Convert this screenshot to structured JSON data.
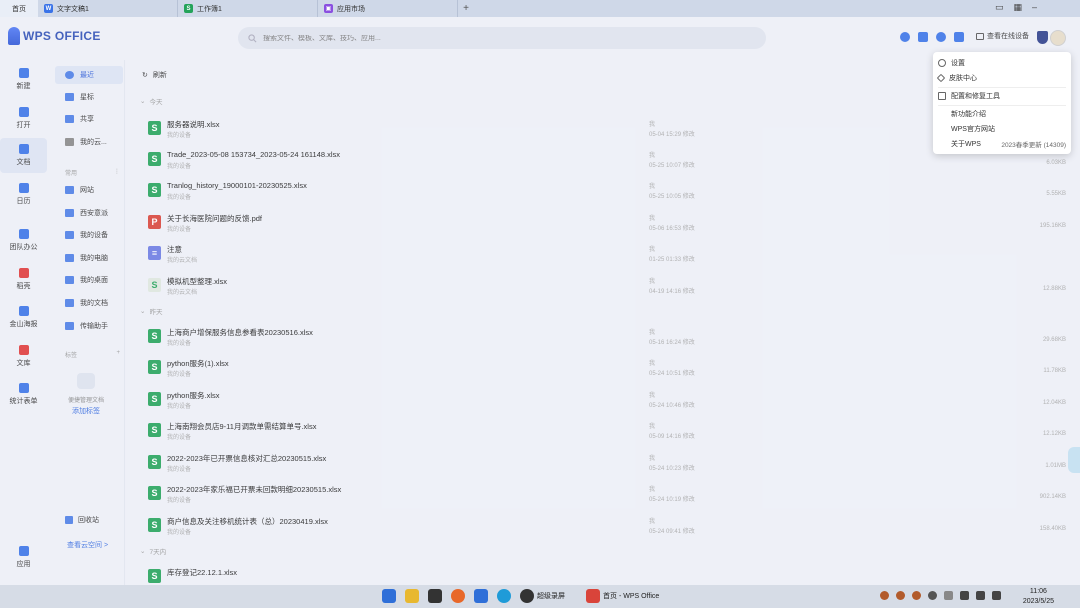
{
  "tabs": [
    {
      "label": "首页",
      "icon": "home-tab",
      "color": "#ffffff"
    },
    {
      "label": "文字文稿1",
      "icon": "writer-doc-icon",
      "color": "#3a73e8",
      "glyph": "W"
    },
    {
      "label": "工作簿1",
      "icon": "spreadsheet-icon",
      "color": "#24a35a",
      "glyph": "S"
    },
    {
      "label": "应用市场",
      "icon": "app-market-icon",
      "color": "#8a4fe0",
      "glyph": "▣"
    }
  ],
  "app": {
    "logo_text": "WPS OFFICE"
  },
  "search": {
    "placeholder": "搜索文件、模板、文库、技巧、应用..."
  },
  "header": {
    "online_devices": "查看在线设备"
  },
  "rail": [
    {
      "label": "新建",
      "icon": "plus-icon",
      "color": "#3a73e8"
    },
    {
      "label": "打开",
      "icon": "folder-open-icon",
      "color": "#3a73e8"
    },
    {
      "label": "文档",
      "icon": "document-icon",
      "color": "#3a73e8",
      "active": true
    },
    {
      "label": "日历",
      "icon": "calendar-icon",
      "color": "#3a73e8"
    },
    {
      "label": "团队办公",
      "icon": "team-icon",
      "color": "#3a73e8"
    },
    {
      "label": "稻壳",
      "icon": "docer-icon",
      "color": "#e03a3a"
    },
    {
      "label": "金山海报",
      "icon": "poster-icon",
      "color": "#3a73e8"
    },
    {
      "label": "文库",
      "icon": "library-icon",
      "color": "#e03a3a"
    },
    {
      "label": "统计表单",
      "icon": "form-icon",
      "color": "#3a73e8"
    },
    {
      "label": "应用",
      "icon": "apps-grid-icon",
      "color": "#3a73e8"
    }
  ],
  "nav": {
    "primary": [
      {
        "label": "最近",
        "icon": "clock-icon",
        "active": true
      },
      {
        "label": "星标",
        "icon": "star-icon"
      },
      {
        "label": "共享",
        "icon": "share-icon"
      },
      {
        "label": "我的云...",
        "icon": "cloud-icon"
      }
    ],
    "common_header": "常用",
    "common": [
      {
        "label": "网站",
        "icon": "folder-icon"
      },
      {
        "label": "西安意派",
        "icon": "folder-icon"
      },
      {
        "label": "我的设备",
        "icon": "folder-icon"
      },
      {
        "label": "我的电脑",
        "icon": "folder-icon"
      },
      {
        "label": "我的桌面",
        "icon": "folder-icon"
      },
      {
        "label": "我的文档",
        "icon": "folder-icon"
      },
      {
        "label": "传输助手",
        "icon": "folder-icon"
      }
    ],
    "tags_header": "标签",
    "tags_empty_text": "便捷管理文档",
    "tags_add": "添加标签",
    "recycle": "回收站",
    "cloud_space": "查看云空间 >"
  },
  "main": {
    "refresh": "刷新",
    "groups": [
      {
        "label": "今天",
        "files": [
          {
            "name": "服务器说明.xlsx",
            "type": "xlsx",
            "location": "我的设备",
            "owner": "我",
            "time": "05-04 15:29 修改",
            "size": ""
          },
          {
            "name": "Trade_2023-05-08 153734_2023-05-24 161148.xlsx",
            "type": "xlsx",
            "location": "我的设备",
            "owner": "我",
            "time": "05-25 10:07 修改",
            "size": "6.03KB"
          },
          {
            "name": "Tranlog_history_19000101-20230525.xlsx",
            "type": "xlsx",
            "location": "我的设备",
            "owner": "我",
            "time": "05-25 10:05 修改",
            "size": "5.55KB"
          },
          {
            "name": "关于长海医院问题的反馈.pdf",
            "type": "pdf",
            "location": "我的设备",
            "owner": "我",
            "time": "05-06 16:53 修改",
            "size": "195.16KB"
          },
          {
            "name": "注意",
            "type": "note",
            "location": "我的云文档",
            "owner": "我",
            "time": "01-25 01:33 修改",
            "size": ""
          },
          {
            "name": "模拟机型整理.xlsx",
            "type": "xlsx",
            "location": "我的云文档",
            "owner": "我",
            "time": "04-19 14:16 修改",
            "size": "12.88KB"
          }
        ]
      },
      {
        "label": "昨天",
        "files": [
          {
            "name": "上海商户增保服务信息参看表20230516.xlsx",
            "type": "xlsx",
            "location": "我的设备",
            "owner": "我",
            "time": "05-16 16:24 修改",
            "size": "29.68KB"
          },
          {
            "name": "python服务(1).xlsx",
            "type": "xlsx",
            "location": "我的设备",
            "owner": "我",
            "time": "05-24 10:51 修改",
            "size": "11.78KB"
          },
          {
            "name": "python服务.xlsx",
            "type": "xlsx",
            "location": "我的设备",
            "owner": "我",
            "time": "05-24 10:46 修改",
            "size": "12.04KB"
          },
          {
            "name": "上海南翔会员店9-11月调款单需结算单号.xlsx",
            "type": "xlsx",
            "location": "我的设备",
            "owner": "我",
            "time": "05-09 14:16 修改",
            "size": "12.12KB"
          },
          {
            "name": "2022-2023年已开票信息核对汇总20230515.xlsx",
            "type": "xlsx",
            "location": "我的设备",
            "owner": "我",
            "time": "05-24 10:23 修改",
            "size": "1.01MB"
          },
          {
            "name": "2022-2023年家乐福已开票未回款明细20230515.xlsx",
            "type": "xlsx",
            "location": "我的设备",
            "owner": "我",
            "time": "05-24 10:19 修改",
            "size": "902.14KB"
          },
          {
            "name": "商户信息及关注移机统计表（总）20230419.xlsx",
            "type": "xlsx",
            "location": "我的设备",
            "owner": "我",
            "time": "05-24 09:41 修改",
            "size": "158.40KB"
          }
        ]
      },
      {
        "label": "7天内",
        "files": [
          {
            "name": "库存登记22.12.1.xlsx",
            "type": "xlsx",
            "location": "我的设备",
            "owner": "",
            "time": "",
            "size": ""
          }
        ]
      }
    ]
  },
  "menu": {
    "items": [
      {
        "label": "设置",
        "icon": "gear-icon"
      },
      {
        "label": "皮肤中心",
        "icon": "brush-icon"
      },
      {
        "label": "配置和修复工具",
        "icon": "wrench-icon"
      },
      {
        "label": "新功能介绍",
        "icon": ""
      },
      {
        "label": "WPS官方网站",
        "icon": ""
      },
      {
        "label": "关于WPS",
        "icon": "",
        "extra": "2023春季更新 (14309)"
      }
    ]
  },
  "taskbar": {
    "apps": [
      {
        "label": "",
        "icon": "windows-start-icon",
        "color": "#2f6fd8"
      },
      {
        "label": "",
        "icon": "file-explorer-icon",
        "color": "#e8b830"
      },
      {
        "label": "",
        "icon": "xmind-icon",
        "color": "#333333"
      },
      {
        "label": "",
        "icon": "firefox-icon",
        "color": "#e8682a"
      },
      {
        "label": "",
        "icon": "mail-icon",
        "color": "#2f6fd8"
      },
      {
        "label": "",
        "icon": "edge-icon",
        "color": "#1f9bd8"
      },
      {
        "label": "超级录屏",
        "icon": "screen-recorder-icon",
        "color": "#333333"
      },
      {
        "label": "首页 - WPS Office",
        "icon": "wps-taskbar-icon",
        "color": "#d9443a"
      }
    ],
    "time": "11:06",
    "date": "2023/5/25"
  }
}
